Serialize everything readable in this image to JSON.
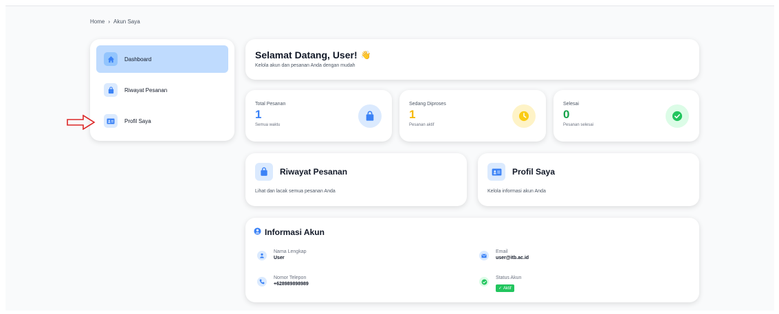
{
  "breadcrumb": {
    "home": "Home",
    "separator": "›",
    "current": "Akun Saya"
  },
  "sidebar": {
    "items": [
      {
        "label": "Dashboard",
        "icon": "home-icon",
        "active": true
      },
      {
        "label": "Riwayat Pesanan",
        "icon": "shopping-bag-icon",
        "active": false
      },
      {
        "label": "Profil Saya",
        "icon": "id-card-icon",
        "active": false
      }
    ]
  },
  "welcome": {
    "title": "Selamat Datang, User!",
    "emoji": "👋",
    "subtitle": "Kelola akun dan pesanan Anda dengan mudah"
  },
  "stats": [
    {
      "label": "Total Pesanan",
      "value": "1",
      "note": "Semua waktu",
      "color": "#3b82f6",
      "icon": "shopping-bag-icon"
    },
    {
      "label": "Sedang Diproses",
      "value": "1",
      "note": "Pesanan aktif",
      "color": "#f5b800",
      "icon": "clock-icon"
    },
    {
      "label": "Selesai",
      "value": "0",
      "note": "Pesanan selesai",
      "color": "#16a34a",
      "icon": "check-circle-icon"
    }
  ],
  "features": [
    {
      "title": "Riwayat Pesanan",
      "desc": "Lihat dan lacak semua pesanan Anda",
      "icon": "shopping-bag-icon"
    },
    {
      "title": "Profil Saya",
      "desc": "Kelola informasi akun Anda",
      "icon": "id-card-icon"
    }
  ],
  "info": {
    "title": "Informasi Akun",
    "fields": {
      "name": {
        "label": "Nama Lengkap",
        "value": "User"
      },
      "email": {
        "label": "Email",
        "value": "user@itb.ac.id"
      },
      "phone": {
        "label": "Nomor Telepon",
        "value": "+628989898989"
      },
      "status": {
        "label": "Status Akun",
        "value": "Aktif"
      }
    }
  },
  "colors": {
    "accent": "#3b82f6",
    "active_bg": "#bfdbfe",
    "success": "#22c55e",
    "annotation_arrow": "#dc2626"
  }
}
